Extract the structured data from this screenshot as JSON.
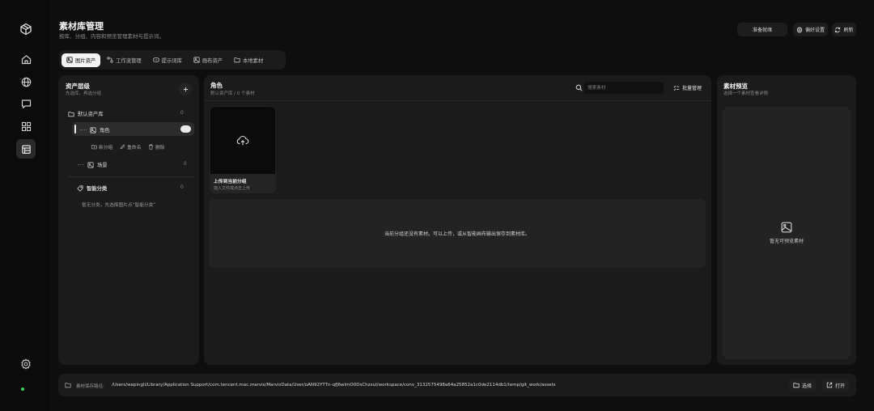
{
  "header": {
    "title": "素材库管理",
    "subtitle": "按库、分组、内容和预览管理素材与提示词。",
    "btn_ready": "准备就绪",
    "btn_prefs": "偏好设置",
    "btn_refresh": "刷新"
  },
  "tabs": [
    {
      "label": "图片资产",
      "icon": "image-icon",
      "active": true
    },
    {
      "label": "工作流管理",
      "icon": "workflow-icon",
      "active": false
    },
    {
      "label": "提示词库",
      "icon": "prompt-icon",
      "active": false
    },
    {
      "label": "画布资产",
      "icon": "canvas-icon",
      "active": false
    },
    {
      "label": "本地素材",
      "icon": "folder-icon",
      "active": false
    }
  ],
  "hierarchy": {
    "title": "资产层级",
    "subtitle": "先选库，再选分组",
    "library_name": "默认资产库",
    "library_count": "0",
    "group_selected": "角色",
    "actions": {
      "new_group": "新分组",
      "rename": "重命名",
      "delete": "删除"
    },
    "group_other": "场景",
    "group_other_count": "0",
    "smart_title": "智能分类",
    "smart_count": "0",
    "smart_empty": "暂无分类，先选择图片点“智能分类”"
  },
  "content": {
    "title": "角色",
    "subtitle": "默认资产库 / 0 个素材",
    "search_placeholder": "搜索素材",
    "batch_label": "批量管理",
    "upload_title": "上传到当前分组",
    "upload_sub": "拖入文件或点击上传",
    "empty_text": "当前分组还没有素材。可以上传，或从智能画布输出保存到素材库。"
  },
  "preview": {
    "title": "素材预览",
    "subtitle": "选择一个素材查看详情",
    "empty": "暂无可预览素材"
  },
  "footer": {
    "label": "素材保存路径:",
    "path": "/Users/wepingli/Library/Application Support/com.tencent.mac.marvis/MarvisData/User/oAN92YTTn-qfJ6wlmO0DsChzxul/workspace/conv_3132575498a64a25852a1c0de2114db1/temp/git_work/assets",
    "btn_choose": "选择",
    "btn_open": "打开"
  },
  "colors": {
    "background": "#0e0e0e",
    "panel": "#1b1b1b",
    "active_tab": "#f3f3f3",
    "status_online": "#3ccf5a"
  }
}
